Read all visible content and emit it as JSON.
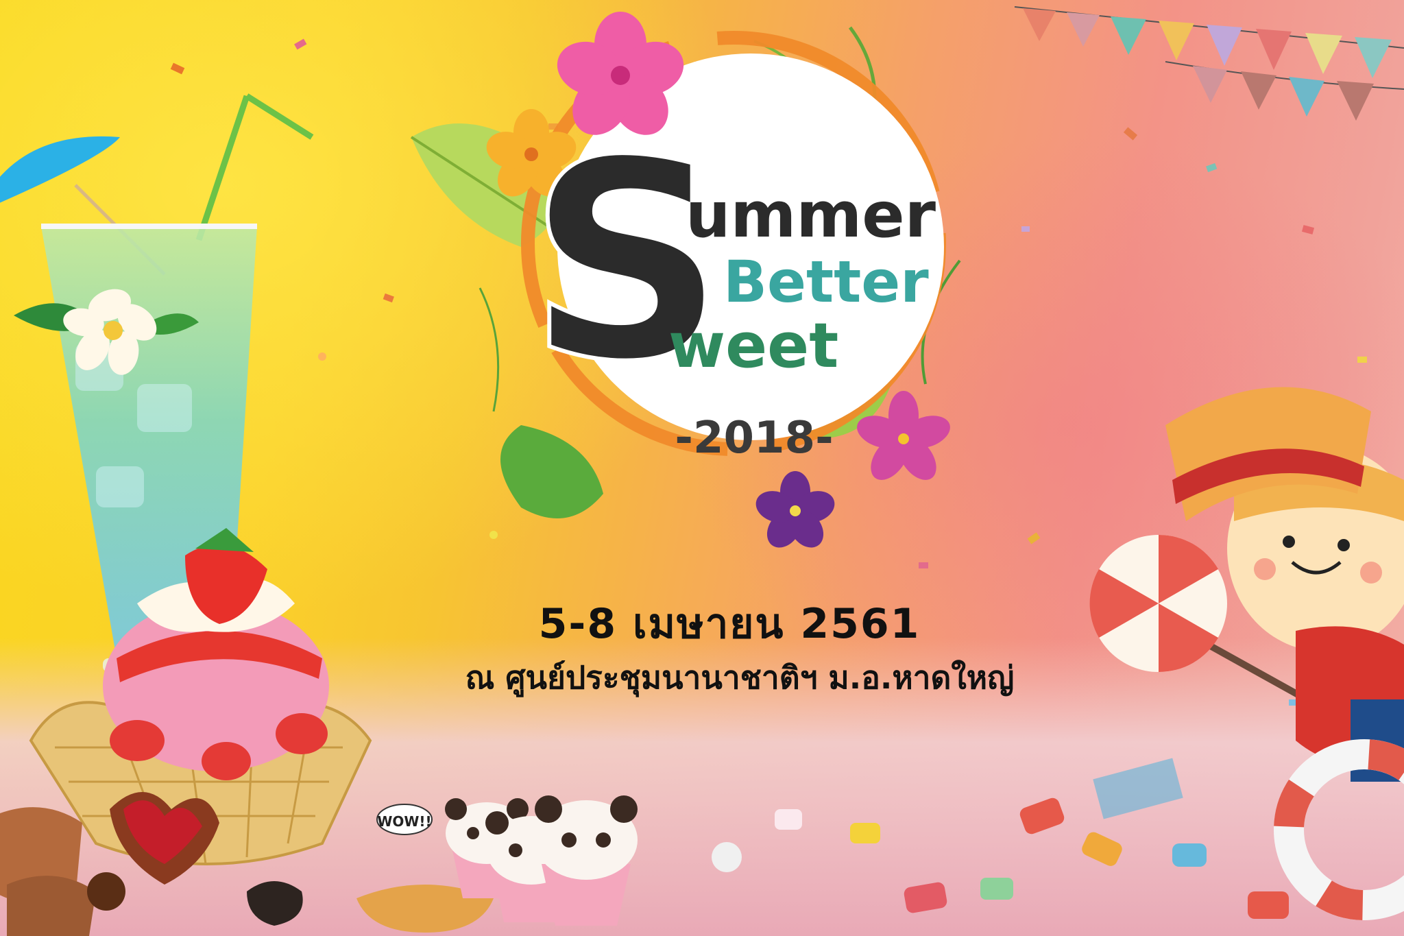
{
  "poster": {
    "title": {
      "initial": "S",
      "line1": "ummer",
      "line2": "Better",
      "line3": "weet",
      "year": "-2018-"
    },
    "date": "5-8 เมษายน 2561",
    "venue": "ณ ศูนย์ประชุมนานาชาติฯ ม.อ.หาดใหญ่",
    "cookie_label": "WOW!!"
  },
  "colors": {
    "title_dark": "#2b2b2b",
    "title_teal": "#3aa6a0",
    "title_green": "#2f8a5e",
    "badge_bg": "#ffffff",
    "ring": "#f08a2a"
  }
}
